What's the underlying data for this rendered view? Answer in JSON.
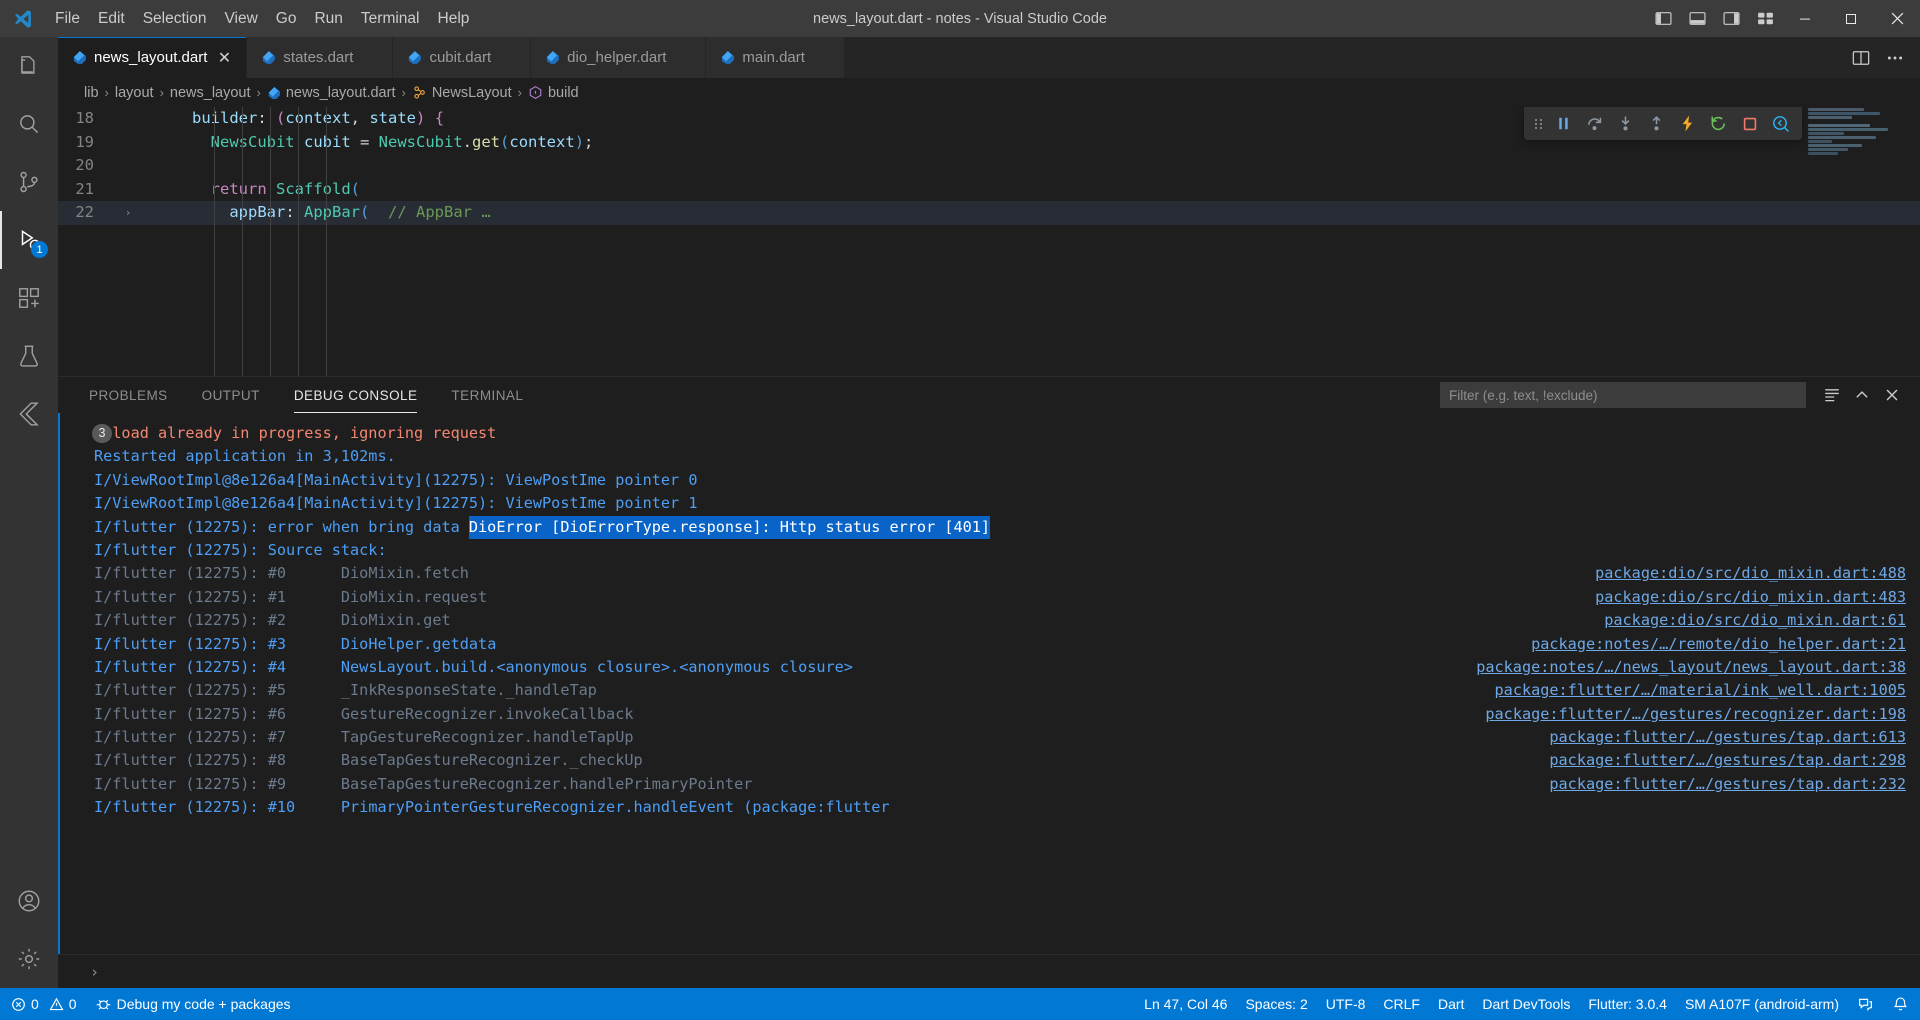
{
  "window": {
    "title": "news_layout.dart - notes - Visual Studio Code",
    "menu": [
      "File",
      "Edit",
      "Selection",
      "View",
      "Go",
      "Run",
      "Terminal",
      "Help"
    ],
    "controls": {
      "minimize": "─",
      "maximize": "☐",
      "close": "✕"
    },
    "layout_icons": [
      "toggle-primary-sidebar",
      "toggle-panel",
      "toggle-secondary-sidebar",
      "customize-layout"
    ]
  },
  "activitybar": {
    "items": [
      {
        "name": "explorer",
        "icon": "files-icon",
        "badge": ""
      },
      {
        "name": "search",
        "icon": "search-icon",
        "badge": ""
      },
      {
        "name": "source-control",
        "icon": "source-control-icon",
        "badge": ""
      },
      {
        "name": "run-and-debug",
        "icon": "debug-icon",
        "badge": "1"
      },
      {
        "name": "extensions",
        "icon": "extensions-icon",
        "badge": ""
      },
      {
        "name": "testing",
        "icon": "beaker-icon",
        "badge": ""
      },
      {
        "name": "flutter-inspector",
        "icon": "flutter-icon",
        "badge": ""
      }
    ],
    "bottom": [
      {
        "name": "accounts",
        "icon": "account-icon"
      },
      {
        "name": "manage",
        "icon": "gear-icon"
      }
    ]
  },
  "tabs": [
    {
      "label": "news_layout.dart",
      "icon": "dart-file-icon",
      "active": true,
      "dirty": false,
      "close": "✕"
    },
    {
      "label": "states.dart",
      "icon": "dart-file-icon",
      "active": false
    },
    {
      "label": "cubit.dart",
      "icon": "dart-file-icon",
      "active": false
    },
    {
      "label": "dio_helper.dart",
      "icon": "dart-file-icon",
      "active": false
    },
    {
      "label": "main.dart",
      "icon": "dart-file-icon",
      "active": false
    }
  ],
  "tabs_actions": [
    "split-editor-icon",
    "more-actions-icon"
  ],
  "breadcrumb": [
    {
      "label": "lib",
      "icon": ""
    },
    {
      "label": "layout",
      "icon": ""
    },
    {
      "label": "news_layout",
      "icon": ""
    },
    {
      "label": "news_layout.dart",
      "icon": "dart-file-icon"
    },
    {
      "label": "NewsLayout",
      "icon": "class-icon"
    },
    {
      "label": "build",
      "icon": "method-icon"
    }
  ],
  "breadcrumb_separator": "›",
  "editor": {
    "lines": [
      {
        "num": "18",
        "indent": 0,
        "tokens": [
          {
            "t": "      ",
            "c": "plain"
          },
          {
            "t": "builder",
            "c": "var"
          },
          {
            "t": ": ",
            "c": "plain"
          },
          {
            "t": "(",
            "c": "pink"
          },
          {
            "t": "context",
            "c": "var"
          },
          {
            "t": ", ",
            "c": "plain"
          },
          {
            "t": "state",
            "c": "var"
          },
          {
            "t": ")",
            "c": "pink"
          },
          {
            "t": " ",
            "c": "plain"
          },
          {
            "t": "{",
            "c": "pink"
          }
        ]
      },
      {
        "num": "19",
        "indent": 0,
        "tokens": [
          {
            "t": "        ",
            "c": "plain"
          },
          {
            "t": "NewsCubit",
            "c": "type"
          },
          {
            "t": " ",
            "c": "plain"
          },
          {
            "t": "cubit",
            "c": "var"
          },
          {
            "t": " = ",
            "c": "plain"
          },
          {
            "t": "NewsCubit",
            "c": "type"
          },
          {
            "t": ".",
            "c": "plain"
          },
          {
            "t": "get",
            "c": "fn"
          },
          {
            "t": "(",
            "c": "blue"
          },
          {
            "t": "context",
            "c": "var"
          },
          {
            "t": ")",
            "c": "blue"
          },
          {
            "t": ";",
            "c": "plain"
          }
        ]
      },
      {
        "num": "20",
        "indent": 0,
        "tokens": []
      },
      {
        "num": "21",
        "indent": 0,
        "tokens": [
          {
            "t": "        ",
            "c": "plain"
          },
          {
            "t": "return",
            "c": "key"
          },
          {
            "t": " ",
            "c": "plain"
          },
          {
            "t": "Scaffold",
            "c": "type"
          },
          {
            "t": "(",
            "c": "blue"
          }
        ]
      },
      {
        "num": "22",
        "indent": 0,
        "fold": "›",
        "highlight": true,
        "tokens": [
          {
            "t": "          ",
            "c": "plain"
          },
          {
            "t": "appBar",
            "c": "var"
          },
          {
            "t": ": ",
            "c": "plain"
          },
          {
            "t": "AppBar",
            "c": "type"
          },
          {
            "t": "(",
            "c": "blue"
          },
          {
            "t": "  ",
            "c": "plain"
          },
          {
            "t": "// AppBar …",
            "c": "com"
          }
        ]
      }
    ]
  },
  "debug_toolbar": {
    "buttons": [
      {
        "name": "drag-handle",
        "icon": "grip-dots-icon"
      },
      {
        "name": "pause",
        "icon": "pause-icon",
        "color": "#6aa9ee"
      },
      {
        "name": "step-over",
        "icon": "step-over-icon",
        "color": "#8d9aa5"
      },
      {
        "name": "step-into",
        "icon": "step-into-icon",
        "color": "#8d9aa5"
      },
      {
        "name": "step-out",
        "icon": "step-out-icon",
        "color": "#8d9aa5"
      },
      {
        "name": "hot-reload",
        "icon": "lightning-icon",
        "color": "#f7a928"
      },
      {
        "name": "hot-restart",
        "icon": "restart-icon",
        "color": "#6bbf59"
      },
      {
        "name": "stop",
        "icon": "stop-square-icon",
        "color": "#f07b6b"
      },
      {
        "name": "open-devtools",
        "icon": "flutter-devtools-search-icon",
        "color": "#29b6f6"
      }
    ]
  },
  "panel": {
    "tabs": [
      {
        "label": "PROBLEMS",
        "active": false
      },
      {
        "label": "OUTPUT",
        "active": false
      },
      {
        "label": "DEBUG CONSOLE",
        "active": true
      },
      {
        "label": "TERMINAL",
        "active": false
      }
    ],
    "filter": {
      "value": "",
      "placeholder": "Filter (e.g. text, !exclude)"
    },
    "actions": [
      {
        "name": "clear-console",
        "icon": "clear-icon"
      },
      {
        "name": "collapse-panel",
        "icon": "chevron-up-icon"
      },
      {
        "name": "close-panel",
        "icon": "close-icon"
      }
    ],
    "prompt_icon": "›"
  },
  "console": {
    "lines": [
      {
        "badge": "3",
        "segments": [
          {
            "t": "Reload already in progress, ignoring request",
            "c": "c-err"
          }
        ]
      },
      {
        "segments": [
          {
            "t": "Restarted application in 3,102ms.",
            "c": "c-info"
          }
        ]
      },
      {
        "segments": [
          {
            "t": "I/ViewRootImpl@8e126a4[MainActivity](12275): ViewPostIme pointer 0",
            "c": "c-info"
          }
        ]
      },
      {
        "segments": [
          {
            "t": "I/ViewRootImpl@8e126a4[MainActivity](12275): ViewPostIme pointer 1",
            "c": "c-info"
          }
        ]
      },
      {
        "segments": [
          {
            "t": "I/flutter (12275): error when bring data ",
            "c": "c-info"
          },
          {
            "t": "DioError [DioErrorType.response]: Http status error [401]",
            "c": "sel"
          }
        ]
      },
      {
        "segments": [
          {
            "t": "I/flutter (12275): Source stack:",
            "c": "c-info"
          }
        ]
      },
      {
        "segments": [
          {
            "t": "I/flutter (12275): #0      ",
            "c": "c-dim"
          },
          {
            "t": "DioMixin.fetch",
            "c": "c-dim"
          }
        ],
        "link": "package:dio/src/dio_mixin.dart:488"
      },
      {
        "segments": [
          {
            "t": "I/flutter (12275): #1      ",
            "c": "c-dim"
          },
          {
            "t": "DioMixin.request",
            "c": "c-dim"
          }
        ],
        "link": "package:dio/src/dio_mixin.dart:483"
      },
      {
        "segments": [
          {
            "t": "I/flutter (12275): #2      ",
            "c": "c-dim"
          },
          {
            "t": "DioMixin.get",
            "c": "c-dim"
          }
        ],
        "link": "package:dio/src/dio_mixin.dart:61"
      },
      {
        "segments": [
          {
            "t": "I/flutter (12275): #3      ",
            "c": "c-stack"
          },
          {
            "t": "DioHelper.getdata",
            "c": "c-stack"
          }
        ],
        "link": "package:notes/…/remote/dio_helper.dart:21"
      },
      {
        "segments": [
          {
            "t": "I/flutter (12275): #4      ",
            "c": "c-stack"
          },
          {
            "t": "NewsLayout.build.<anonymous closure>.<anonymous closure>",
            "c": "c-stack"
          }
        ],
        "link": "package:notes/…/news_layout/news_layout.dart:38"
      },
      {
        "segments": [
          {
            "t": "I/flutter (12275): #5      ",
            "c": "c-dim"
          },
          {
            "t": "_InkResponseState._handleTap",
            "c": "c-dim"
          }
        ],
        "link": "package:flutter/…/material/ink_well.dart:1005"
      },
      {
        "segments": [
          {
            "t": "I/flutter (12275): #6      ",
            "c": "c-dim"
          },
          {
            "t": "GestureRecognizer.invokeCallback",
            "c": "c-dim"
          }
        ],
        "link": "package:flutter/…/gestures/recognizer.dart:198"
      },
      {
        "segments": [
          {
            "t": "I/flutter (12275): #7      ",
            "c": "c-dim"
          },
          {
            "t": "TapGestureRecognizer.handleTapUp",
            "c": "c-dim"
          }
        ],
        "link": "package:flutter/…/gestures/tap.dart:613"
      },
      {
        "segments": [
          {
            "t": "I/flutter (12275): #8      ",
            "c": "c-dim"
          },
          {
            "t": "BaseTapGestureRecognizer._checkUp",
            "c": "c-dim"
          }
        ],
        "link": "package:flutter/…/gestures/tap.dart:298"
      },
      {
        "segments": [
          {
            "t": "I/flutter (12275): #9      ",
            "c": "c-dim"
          },
          {
            "t": "BaseTapGestureRecognizer.handlePrimaryPointer",
            "c": "c-dim"
          }
        ],
        "link": "package:flutter/…/gestures/tap.dart:232"
      },
      {
        "segments": [
          {
            "t": "I/flutter (12275): #10     ",
            "c": "c-info"
          },
          {
            "t": "PrimaryPointerGestureRecognizer.handleEvent (package:flutter",
            "c": "c-stack"
          }
        ]
      }
    ]
  },
  "statusbar": {
    "left": [
      {
        "name": "problems",
        "icon": "error-warning-icon",
        "label": "0  0",
        "errors": "0",
        "warnings": "0"
      },
      {
        "name": "debug-session",
        "icon": "debug-alt-icon",
        "label": "Debug my code + packages"
      }
    ],
    "right": [
      {
        "name": "cursor-position",
        "label": "Ln 47, Col 46"
      },
      {
        "name": "indentation",
        "label": "Spaces: 2"
      },
      {
        "name": "encoding",
        "label": "UTF-8"
      },
      {
        "name": "eol",
        "label": "CRLF"
      },
      {
        "name": "language-mode",
        "label": "Dart"
      },
      {
        "name": "dart-devtools",
        "label": "Dart DevTools"
      },
      {
        "name": "flutter-version",
        "label": "Flutter: 3.0.4"
      },
      {
        "name": "device",
        "label": "SM A107F (android-arm)"
      },
      {
        "name": "live-share",
        "label": "",
        "icon": "live-share-icon"
      },
      {
        "name": "notifications",
        "label": "",
        "icon": "bell-icon"
      }
    ]
  },
  "colors": {
    "accent": "#0078d4",
    "titlebar": "#3c3c3c",
    "activitybar": "#333333",
    "editor_bg": "#1e1e1e",
    "tab_inactive": "#2d2d2d",
    "selection": "#0a64c8",
    "error": "#f48771",
    "info": "#4e9ef5",
    "link": "#6ea8e6"
  }
}
